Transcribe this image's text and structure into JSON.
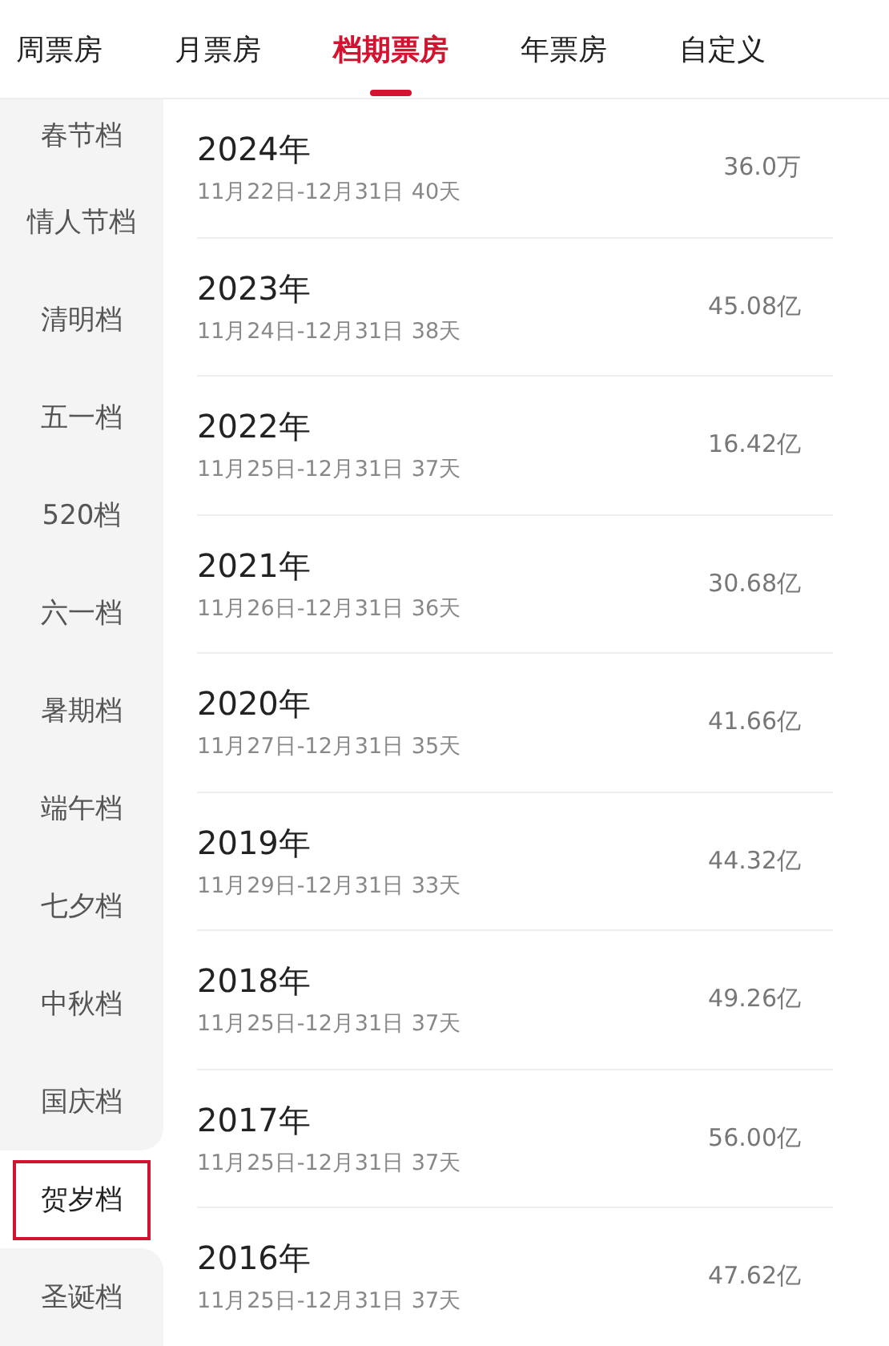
{
  "tabs": [
    {
      "label": "周票房",
      "selected": false
    },
    {
      "label": "月票房",
      "selected": false
    },
    {
      "label": "档期票房",
      "selected": true
    },
    {
      "label": "年票房",
      "selected": false
    },
    {
      "label": "自定义",
      "selected": false
    }
  ],
  "sidebar": {
    "items": [
      {
        "label": "春节档",
        "selected": false
      },
      {
        "label": "情人节档",
        "selected": false
      },
      {
        "label": "清明档",
        "selected": false
      },
      {
        "label": "五一档",
        "selected": false
      },
      {
        "label": "520档",
        "selected": false
      },
      {
        "label": "六一档",
        "selected": false
      },
      {
        "label": "暑期档",
        "selected": false
      },
      {
        "label": "端午档",
        "selected": false
      },
      {
        "label": "七夕档",
        "selected": false
      },
      {
        "label": "中秋档",
        "selected": false
      },
      {
        "label": "国庆档",
        "selected": false
      },
      {
        "label": "贺岁档",
        "selected": true
      },
      {
        "label": "圣诞档",
        "selected": false
      }
    ]
  },
  "rows": [
    {
      "year": "2024年",
      "period": "11月22日-12月31日 40天",
      "box_office": "36.0万"
    },
    {
      "year": "2023年",
      "period": "11月24日-12月31日 38天",
      "box_office": "45.08亿"
    },
    {
      "year": "2022年",
      "period": "11月25日-12月31日 37天",
      "box_office": "16.42亿"
    },
    {
      "year": "2021年",
      "period": "11月26日-12月31日 36天",
      "box_office": "30.68亿"
    },
    {
      "year": "2020年",
      "period": "11月27日-12月31日 35天",
      "box_office": "41.66亿"
    },
    {
      "year": "2019年",
      "period": "11月29日-12月31日 33天",
      "box_office": "44.32亿"
    },
    {
      "year": "2018年",
      "period": "11月25日-12月31日 37天",
      "box_office": "49.26亿"
    },
    {
      "year": "2017年",
      "period": "11月25日-12月31日 37天",
      "box_office": "56.00亿"
    },
    {
      "year": "2016年",
      "period": "11月25日-12月31日 37天",
      "box_office": "47.62亿"
    }
  ]
}
